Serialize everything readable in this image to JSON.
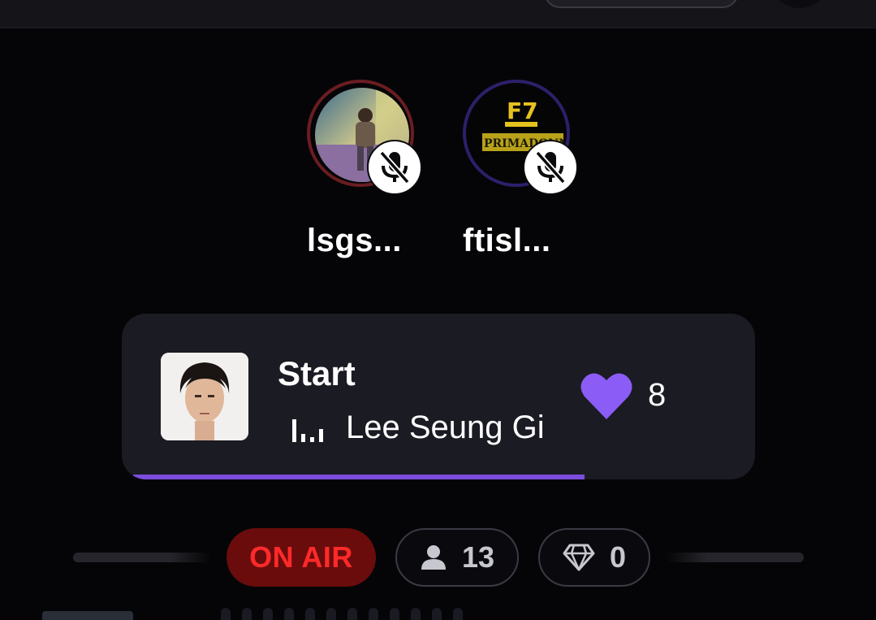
{
  "speakers": [
    {
      "name": "lsgs...",
      "avatar": "concert-photo",
      "mic_state": "muted"
    },
    {
      "name": "ftisl...",
      "avatar": "ft-island-primadonna-logo",
      "mic_state": "muted"
    }
  ],
  "now_playing": {
    "title": "Start",
    "artist": "Lee Seung Gi",
    "likes": "8",
    "progress_percent": 74,
    "icons": {
      "playing": "equalizer-icon",
      "like": "heart-icon"
    }
  },
  "status": {
    "on_air_label": "ON AIR",
    "listeners_count": "13",
    "gems_count": "0",
    "icons": {
      "listeners": "user-icon",
      "gems": "diamond-icon"
    }
  },
  "colors": {
    "background": "#050507",
    "card": "#1b1b23",
    "accent_purple": "#8b5cf6",
    "progress": "#7c4ddc",
    "on_air_bg": "#6a0c0c",
    "on_air_text": "#ff2a2a"
  }
}
